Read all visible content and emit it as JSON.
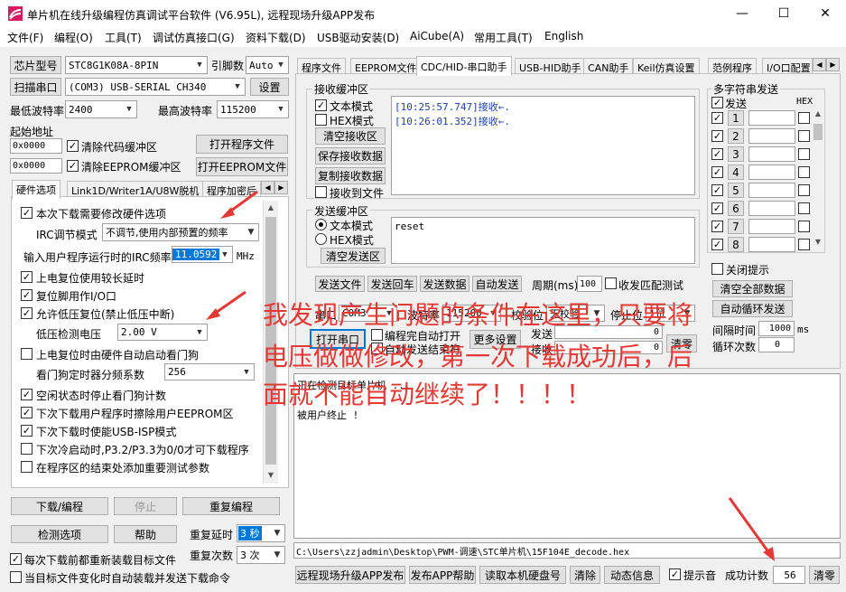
{
  "window": {
    "title": "单片机在线升级编程仿真调试平台软件 (V6.95L), 远程现场升级APP发布",
    "min_glyph": "—",
    "max_glyph": "☐",
    "close_glyph": "✕"
  },
  "menu": [
    "文件(F)",
    "编程(O)",
    "工具(T)",
    "调试仿真接口(G)",
    "资料下载(D)",
    "USB驱动安装(D)",
    "AiCube(A)",
    "常用工具(T)",
    "English"
  ],
  "left": {
    "chip_type_label": "芯片型号",
    "chip_type_value": "STC8G1K08A-8PIN",
    "pins_label": "引脚数",
    "pins_value": "Auto",
    "scan_port_label": "扫描串口",
    "port_value": "(COM3) USB-SERIAL CH340",
    "settings_label": "设置",
    "min_baud_label": "最低波特率",
    "min_baud_value": "2400",
    "max_baud_label": "最高波特率",
    "max_baud_value": "115200",
    "start_addr_label": "起始地址",
    "addr1_value": "0x0000",
    "clear_code_label": "清除代码缓冲区",
    "open_prog_label": "打开程序文件",
    "addr2_value": "0x0000",
    "clear_eeprom_label": "清除EEPROM缓冲区",
    "open_eeprom_label": "打开EEPROM文件",
    "tabs": [
      "硬件选项",
      "Link1D/Writer1A/U8W脱机",
      "程序加密后"
    ],
    "options": {
      "modify_hw": "本次下载需要修改硬件选项",
      "irc_mode_label": "IRC调节模式",
      "irc_mode_value": "不调节,使用内部预置的频率",
      "irc_freq_label": "输入用户程序运行时的IRC频率",
      "irc_freq_value": "11.0592",
      "irc_unit": "MHz",
      "long_delay": "上电复位使用较长延时",
      "reset_io": "复位脚用作I/O口",
      "lvd_reset": "允许低压复位(禁止低压中断)",
      "lvd_label": "低压检测电压",
      "lvd_value": "2.00 V",
      "wdt_auto": "上电复位时由硬件自动启动看门狗",
      "wdt_div_label": "看门狗定时器分频系数",
      "wdt_div_value": "256",
      "idle_stop_wdt": "空闲状态时停止看门狗计数",
      "erase_eeprom": "下次下载用户程序时擦除用户EEPROM区",
      "usb_isp": "下次下载时使能USB-ISP模式",
      "p32_p33": "下次冷启动时,P3.2/P3.3为0/0才可下载程序",
      "add_param": "在程序区的结束处添加重要测试参数"
    },
    "download_label": "下载/编程",
    "stop_label": "停止",
    "reprogram_label": "重复编程",
    "check_opts_label": "检测选项",
    "help_label": "帮助",
    "repeat_delay_label": "重复延时",
    "repeat_delay_value": "3 秒",
    "repeat_count_label": "重复次数",
    "repeat_count_value": "3 次",
    "reload_label": "每次下载前都重新装载目标文件",
    "auto_load_label": "当目标文件变化时自动装载并发送下载命令"
  },
  "right": {
    "tabs": [
      "程序文件",
      "EEPROM文件",
      "CDC/HID-串口助手",
      "USB-HID助手",
      "CAN助手",
      "Keil仿真设置",
      "范例程序",
      "I/O口配置"
    ],
    "recv_title": "接收缓冲区",
    "text_mode": "文本模式",
    "hex_mode": "HEX模式",
    "clear_recv": "清空接收区",
    "save_recv": "保存接收数据",
    "copy_recv": "复制接收数据",
    "recv_to_file": "接收到文件",
    "recv_lines": [
      "[10:25:57.747]接收←.",
      "[10:26:01.352]接收←."
    ],
    "send_title": "发送缓冲区",
    "send_text_mode": "文本模式",
    "send_hex_mode": "HEX模式",
    "clear_send": "清空发送区",
    "send_content": "reset",
    "send_file": "发送文件",
    "send_enter": "发送回车",
    "send_data": "发送数据",
    "auto_send": "自动发送",
    "period_label": "周期(ms)",
    "period_value": "100",
    "match_test": "收发匹配测试",
    "port_label": "串口",
    "port_value": "COM3",
    "baud_label": "波特率",
    "baud_value": "115200",
    "parity_label": "校验位",
    "parity_value": "无校验",
    "stop_label": "停止位",
    "stop_value": "1位",
    "open_port": "打开串口",
    "auto_open": "编程完自动打开",
    "auto_send_end": "自动发送结束符",
    "more_settings": "更多设置",
    "send_count_label": "发送",
    "send_count": "0",
    "recv_count_label": "接收",
    "recv_count": "0",
    "clear_counts": "清零",
    "multi_title": "多字符串发送",
    "send_col": "发送",
    "hex_col": "HEX",
    "rows": [
      "1",
      "2",
      "3",
      "4",
      "5",
      "6",
      "7",
      "8"
    ],
    "close_hint": "关闭提示",
    "clear_all": "清空全部数据",
    "auto_cycle": "自动循环发送",
    "interval_label": "间隔时间",
    "interval_value": "1000",
    "interval_unit": "ms",
    "cycle_label": "循环次数",
    "cycle_value": "0",
    "log_lines": [
      "正在检测目标单片机 ...",
      "被用户终止 !"
    ],
    "file_path": "C:\\Users\\zzjadmin\\Desktop\\PWM-调速\\STC单片机\\15F104E_decode.hex",
    "remote_publish": "远程现场升级APP发布",
    "publish_help": "发布APP帮助",
    "read_disk": "读取本机硬盘号",
    "clear_btn": "清除",
    "anim_info": "动态信息",
    "beep_label": "提示音",
    "success_label": "成功计数",
    "success_value": "56",
    "clear_zero": "清零"
  },
  "annotation": {
    "line1": "我发现产生问题的条件在这里，只要将",
    "line2": "电压做做修改，第一次下载成功后，后",
    "line3": "面就不能自动继续了！！！！"
  },
  "colors": {
    "annotation_red": "#e53935",
    "selection_blue": "#0078d7",
    "recv_text_blue": "#1e3fa8"
  }
}
